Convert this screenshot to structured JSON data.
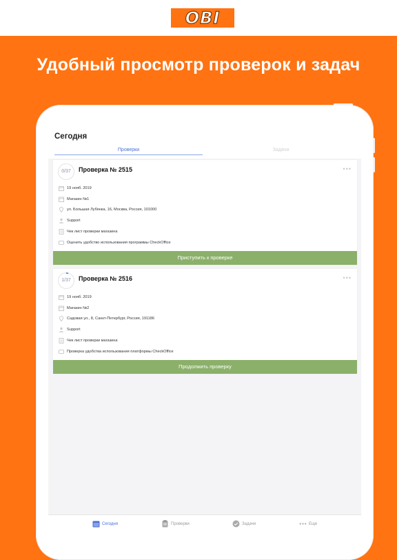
{
  "brand": {
    "logo_text": "OBI",
    "colors": {
      "orange": "#ff7312",
      "green": "#8bb06a",
      "blue": "#4a6fd8"
    }
  },
  "headline": "Удобный просмотр проверок и задач",
  "screen": {
    "title": "Сегодня",
    "tabs": [
      {
        "label": "Проверки",
        "active": true
      },
      {
        "label": "Задачи",
        "active": false
      }
    ]
  },
  "cards": [
    {
      "progress": "0/37",
      "title": "Проверка № 2515",
      "rows": [
        {
          "icon": "calendar-icon",
          "text": "19 нояб. 2019"
        },
        {
          "icon": "store-icon",
          "text": "Магазин №1"
        },
        {
          "icon": "location-icon",
          "text": "ул. Большая Лубянка, 16, Москва, Россия, 101000"
        },
        {
          "icon": "person-icon",
          "text": "Support"
        },
        {
          "icon": "checklist-icon",
          "text": "Чек лист проверки магазина"
        },
        {
          "icon": "comment-icon",
          "text": "Оценить удобство использования программы CheckOffice"
        }
      ],
      "action": "Приступить к проверке"
    },
    {
      "progress": "1/37",
      "title": "Проверка № 2516",
      "rows": [
        {
          "icon": "calendar-icon",
          "text": "19 нояб. 2019"
        },
        {
          "icon": "store-icon",
          "text": "Магазин №2"
        },
        {
          "icon": "location-icon",
          "text": "Садовая ул., 8, Санкт-Петербург, Россия, 191186"
        },
        {
          "icon": "person-icon",
          "text": "Support"
        },
        {
          "icon": "checklist-icon",
          "text": "Чек лист проверки магазина"
        },
        {
          "icon": "comment-icon",
          "text": "Проверка удобства использования платформы CheckOffice"
        }
      ],
      "action": "Продолжить проверку"
    }
  ],
  "nav": [
    {
      "icon": "calendar-icon",
      "label": "Сегодня",
      "active": true
    },
    {
      "icon": "clipboard-icon",
      "label": "Проверки",
      "active": false
    },
    {
      "icon": "check-circle-icon",
      "label": "Задачи",
      "active": false
    },
    {
      "icon": "more-icon",
      "label": "Еще",
      "active": false
    }
  ]
}
